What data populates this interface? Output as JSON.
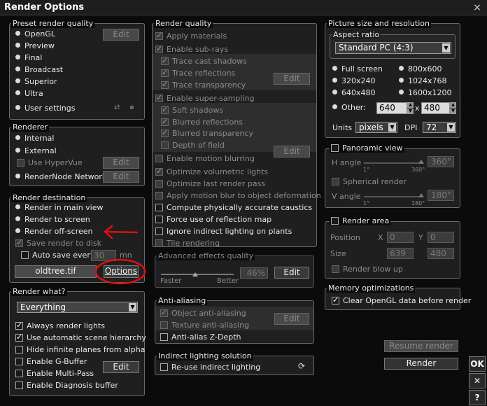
{
  "window": {
    "title": "Render Options",
    "close": "×"
  },
  "preset": {
    "title": "Preset render quality",
    "items": [
      "OpenGL",
      "Preview",
      "Final",
      "Broadcast",
      "Superior",
      "Ultra"
    ],
    "user_settings": "User settings",
    "edit": "Edit"
  },
  "renderer": {
    "title": "Renderer",
    "internal": "Internal",
    "external": "External",
    "use_hypervue": "Use HyperVue",
    "rendernode": "RenderNode Network",
    "edit": "Edit"
  },
  "destination": {
    "title": "Render destination",
    "main_view": "Render in main view",
    "to_screen": "Render to screen",
    "off_screen": "Render off-screen",
    "save_disk": "Save render to disk",
    "auto_save": "Auto save every",
    "auto_save_value": "30",
    "auto_save_unit": "mn",
    "file": "oldtree.tif",
    "options": "Options"
  },
  "what": {
    "title": "Render what?",
    "selected": "Everything",
    "always_lights": "Always render lights",
    "auto_hierarchy": "Use automatic scene hierarchy",
    "hide_planes": "Hide infinite planes from alpha",
    "gbuffer": "Enable G-Buffer",
    "multipass": "Enable Multi-Pass",
    "diagnosis": "Enable Diagnosis buffer",
    "edit": "Edit"
  },
  "quality": {
    "title": "Render quality",
    "apply_materials": "Apply materials",
    "enable_subrays": "Enable sub-rays",
    "trace_cast": "Trace cast shadows",
    "trace_reflections": "Trace reflections",
    "trace_transparency": "Trace transparency",
    "super_sampling": "Enable super-sampling",
    "soft_shadows": "Soft shadows",
    "blurred_reflections": "Blurred reflections",
    "blurred_transparency": "Blurred transparency",
    "depth_of_field": "Depth of field",
    "motion_blurring": "Enable motion blurring",
    "volumetric": "Optimize volumetric lights",
    "last_render": "Optimize last render pass",
    "motion_deform": "Apply motion blur to object deformation",
    "caustics": "Compute physically accurate caustics",
    "reflection_map": "Force use of reflection map",
    "ignore_indirect": "Ignore indirect lighting on plants",
    "tile": "Tile rendering",
    "edit": "Edit"
  },
  "advanced": {
    "title": "Advanced effects quality",
    "faster": "Faster",
    "better": "Better",
    "value": "46%",
    "edit": "Edit"
  },
  "antialiasing": {
    "title": "Anti-aliasing",
    "object": "Object anti-aliasing",
    "texture": "Texture anti-aliasing",
    "zdepth": "Anti-alias Z-Depth",
    "edit": "Edit"
  },
  "indirect": {
    "title": "Indirect lighting solution",
    "reuse": "Re-use indirect lighting"
  },
  "picture": {
    "title": "Picture size and resolution",
    "aspect_title": "Aspect ratio",
    "aspect_value": "Standard PC (4:3)",
    "sizes_left": [
      "Full screen",
      "320x240",
      "640x480"
    ],
    "sizes_right": [
      "800x600",
      "1024x768",
      "1600x1200"
    ],
    "other": "Other:",
    "width": "640",
    "x": "x",
    "height": "480",
    "units_label": "Units",
    "units_value": "pixels",
    "dpi_label": "DPI",
    "dpi_value": "72"
  },
  "panoramic": {
    "title": "Panoramic view",
    "h_angle": "H angle",
    "h_value": "360°",
    "h_min": "1°",
    "h_max": "360°",
    "spherical": "Spherical render",
    "v_angle": "V angle",
    "v_value": "180°",
    "v_min": "1°",
    "v_max": "180°"
  },
  "area": {
    "title": "Render area",
    "position": "Position",
    "x": "X",
    "x_value": "0",
    "y": "Y",
    "y_value": "0",
    "size": "Size",
    "w_value": "639",
    "h_value": "480",
    "blow_up": "Render blow up"
  },
  "memory": {
    "title": "Memory optimizations",
    "clear_opengl": "Clear OpenGL data before render"
  },
  "actions": {
    "resume": "Resume render",
    "render": "Render",
    "ok": "OK",
    "cancel": "✕",
    "help": "?"
  },
  "annotation": {
    "arrow_color": "#e01010"
  }
}
